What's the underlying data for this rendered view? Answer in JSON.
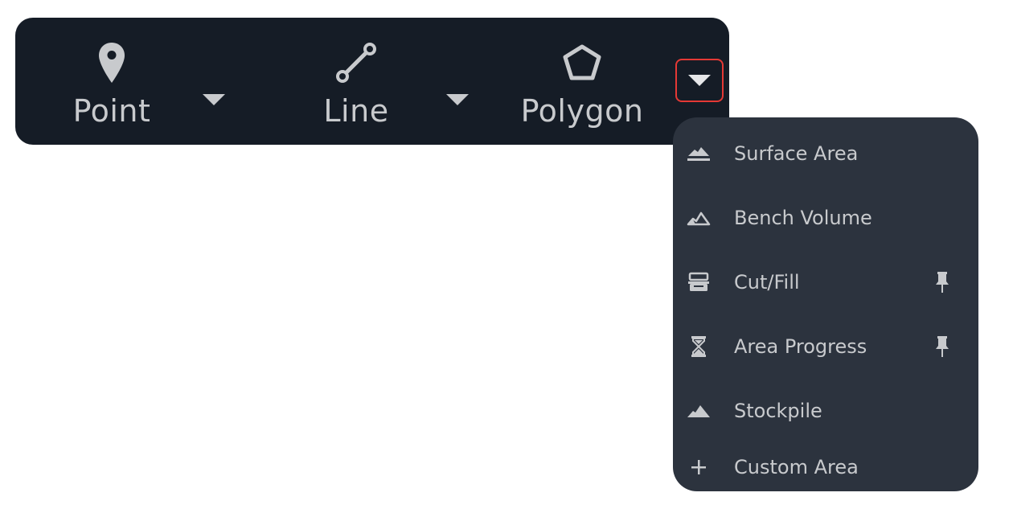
{
  "toolbar": {
    "tools": [
      {
        "label": "Point",
        "icon": "map-pin-icon"
      },
      {
        "label": "Line",
        "icon": "line-segment-icon"
      },
      {
        "label": "Polygon",
        "icon": "pentagon-icon"
      }
    ],
    "caret_icon": "caret-down-icon",
    "highlight_color": "#e53935",
    "background_color": "#151c26"
  },
  "polygon_menu": {
    "background_color": "#2c333e",
    "items": [
      {
        "label": "Surface Area",
        "icon": "surface-area-icon",
        "pinned": false
      },
      {
        "label": "Bench Volume",
        "icon": "bench-volume-icon",
        "pinned": false
      },
      {
        "label": "Cut/Fill",
        "icon": "cut-fill-icon",
        "pinned": true
      },
      {
        "label": "Area Progress",
        "icon": "hourglass-icon",
        "pinned": true
      },
      {
        "label": "Stockpile",
        "icon": "stockpile-icon",
        "pinned": false
      },
      {
        "label": "Custom Area",
        "icon": "plus-icon",
        "pinned": false
      }
    ]
  }
}
